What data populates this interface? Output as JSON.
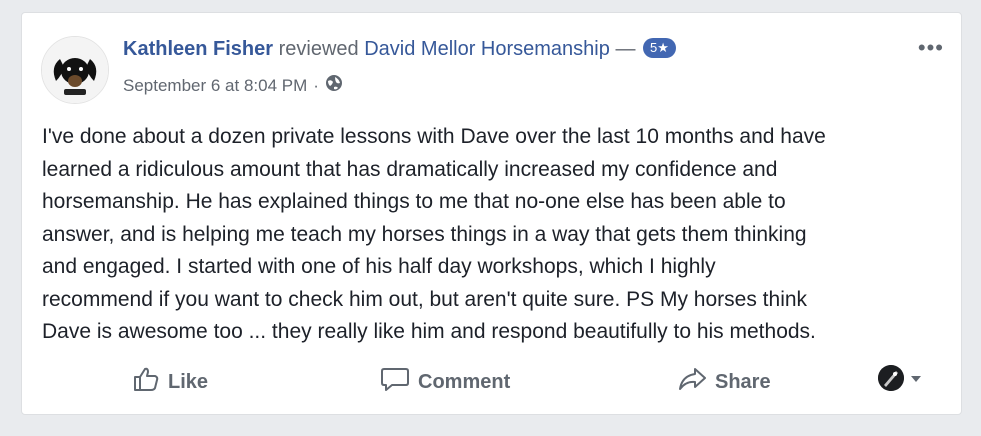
{
  "post": {
    "author_name": "Kathleen Fisher",
    "action_word": "reviewed",
    "page_name": "David Mellor Horsemanship",
    "dash": "—",
    "rating": "5★",
    "timestamp": "September 6 at 8:04 PM",
    "separator": "·",
    "privacy_icon": "globe-icon",
    "body_lines": [
      "I've done about a dozen private lessons with Dave over the last 10 months and have",
      "learned a ridiculous amount that has dramatically increased my confidence and",
      "horsemanship. He has explained things to me that no-one else has been able to",
      "answer, and is helping me teach my horses things in a way that gets them thinking",
      "and engaged. I started with one of his half day workshops, which I highly",
      "recommend if you want to check him out, but aren't quite sure. PS My horses think",
      "Dave is awesome too ... they really like him and respond beautifully to his methods."
    ],
    "more_options": "•••"
  },
  "actions": {
    "like_label": "Like",
    "comment_label": "Comment",
    "share_label": "Share"
  },
  "colors": {
    "link": "#365899",
    "accent": "#4267b2",
    "text": "#1d2129",
    "muted": "#616770"
  }
}
